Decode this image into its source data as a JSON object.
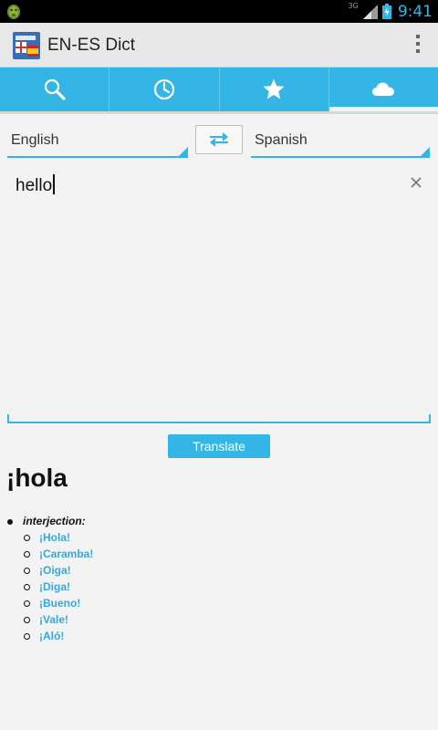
{
  "status_bar": {
    "network": "3G",
    "time": "9:41"
  },
  "app": {
    "title": "EN-ES Dict"
  },
  "tabs": [
    {
      "icon": "search-icon",
      "active": false
    },
    {
      "icon": "history-clock-icon",
      "active": false
    },
    {
      "icon": "favorites-star-icon",
      "active": false
    },
    {
      "icon": "cloud-icon",
      "active": true
    }
  ],
  "languages": {
    "from": "English",
    "to": "Spanish"
  },
  "input": {
    "value": "hello"
  },
  "translate_button": {
    "label": "Translate"
  },
  "result": {
    "word": "¡hola",
    "part_of_speech": "interjection:",
    "senses": [
      "¡Hola!",
      "¡Caramba!",
      "¡Oiga!",
      "¡Diga!",
      "¡Bueno!",
      "¡Vale!",
      "¡Aló!"
    ]
  },
  "colors": {
    "accent": "#33b5e5",
    "link": "#33a8dc"
  }
}
